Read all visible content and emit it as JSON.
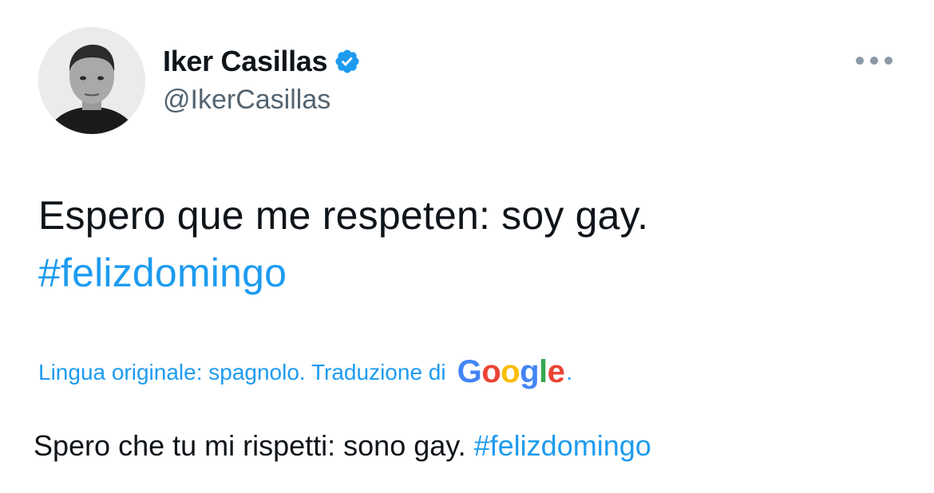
{
  "tweet": {
    "display_name": "Iker Casillas",
    "handle": "@IkerCasillas",
    "verified": true,
    "more_icon": "ellipsis-icon",
    "text": "Espero que me respeten: soy gay.",
    "hashtag": "#felizdomingo",
    "translation_label": "Lingua originale: spagnolo. Traduzione di",
    "translation_provider": "Google",
    "translation_suffix": ".",
    "translated_text": "Spero che tu mi rispetti: sono gay.",
    "translated_hashtag": "#felizdomingo"
  },
  "colors": {
    "link": "#1d9bf0",
    "text": "#0f1419",
    "secondary": "#536471",
    "verified": "#1d9bf0"
  }
}
